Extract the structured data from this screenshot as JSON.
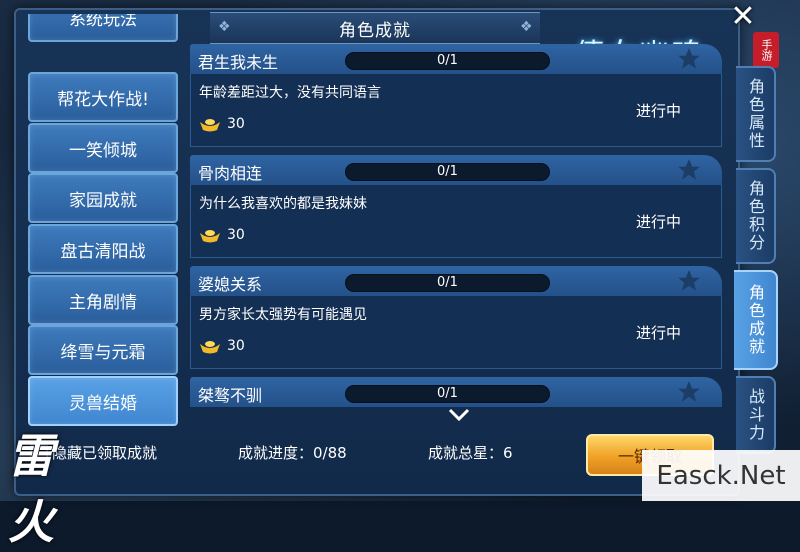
{
  "window": {
    "title": "角色成就"
  },
  "logo": {
    "text": "倩女幽魂",
    "seal": "手游"
  },
  "categories": [
    {
      "label": "系统玩法"
    },
    {
      "label": "帮花大作战!"
    },
    {
      "label": "一笑倾城"
    },
    {
      "label": "家园成就"
    },
    {
      "label": "盘古清阳战"
    },
    {
      "label": "主角剧情"
    },
    {
      "label": "绛雪与元霜"
    },
    {
      "label": "灵兽结婚",
      "active": true
    }
  ],
  "achievements": [
    {
      "name": "君生我未生",
      "progress_text": "0/1",
      "progress": 0,
      "description": "年龄差距过大，没有共同语言",
      "reward": "30",
      "status": "进行中"
    },
    {
      "name": "骨肉相连",
      "progress_text": "0/1",
      "progress": 0,
      "description": "为什么我喜欢的都是我妹妹",
      "reward": "30",
      "status": "进行中"
    },
    {
      "name": "婆媳关系",
      "progress_text": "0/1",
      "progress": 0,
      "description": "男方家长太强势有可能遇见",
      "reward": "30",
      "status": "进行中"
    },
    {
      "name": "桀骜不驯",
      "progress_text": "0/1",
      "progress": 0
    }
  ],
  "side_tabs": [
    {
      "label": "角色属性"
    },
    {
      "label": "角色积分"
    },
    {
      "label": "角色成就",
      "active": true
    },
    {
      "label": "战斗力"
    }
  ],
  "footer": {
    "hide_label": "隐藏已领取成就",
    "progress_label": "成就进度：0/88",
    "stars_label": "成就总星：6",
    "claim_button": "一键领取"
  },
  "corner_logo": "雷火",
  "watermark": "Easck.Net",
  "colors": {
    "panel": "#173356",
    "card_header": "#2f64a3",
    "accent_gold": "#f0a125",
    "active_tab": "#5aa2e6"
  },
  "icons": [
    "close-icon",
    "star-icon",
    "ingot-icon",
    "chevron-down-icon"
  ]
}
